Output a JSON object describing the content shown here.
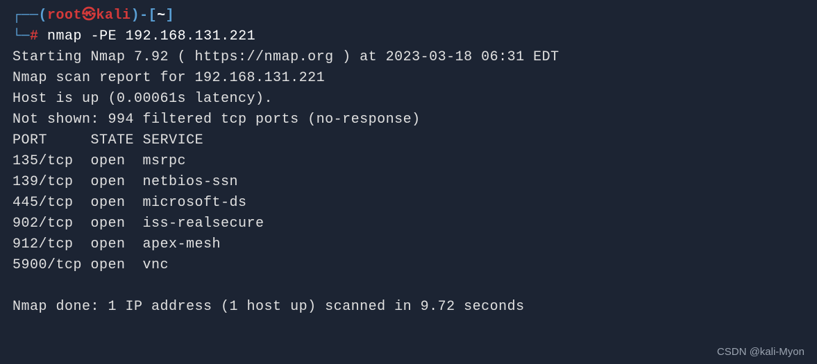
{
  "prompt": {
    "line1_bracket_open": "┌──",
    "paren_open": "(",
    "user": "root",
    "symbol": "㉿",
    "host": "kali",
    "paren_close": ")",
    "dash": "-",
    "bracket_open": "[",
    "tilde": "~",
    "bracket_close": "]",
    "line2_bracket": "└─",
    "hash": "#",
    "command": "nmap",
    "flag": "-PE",
    "target": "192.168.131.221"
  },
  "output": {
    "starting": "Starting Nmap 7.92 ( https://nmap.org ) at 2023-03-18 06:31 EDT",
    "scan_report": "Nmap scan report for 192.168.131.221",
    "host_up": "Host is up (0.00061s latency).",
    "not_shown": "Not shown: 994 filtered tcp ports (no-response)",
    "header_port": "PORT",
    "header_state": "STATE",
    "header_service": "SERVICE",
    "ports": [
      {
        "port": "135/tcp",
        "state": "open",
        "service": "msrpc"
      },
      {
        "port": "139/tcp",
        "state": "open",
        "service": "netbios-ssn"
      },
      {
        "port": "445/tcp",
        "state": "open",
        "service": "microsoft-ds"
      },
      {
        "port": "902/tcp",
        "state": "open",
        "service": "iss-realsecure"
      },
      {
        "port": "912/tcp",
        "state": "open",
        "service": "apex-mesh"
      },
      {
        "port": "5900/tcp",
        "state": "open",
        "service": "vnc"
      }
    ],
    "done": "Nmap done: 1 IP address (1 host up) scanned in 9.72 seconds"
  },
  "watermark": "CSDN @kali-Myon"
}
